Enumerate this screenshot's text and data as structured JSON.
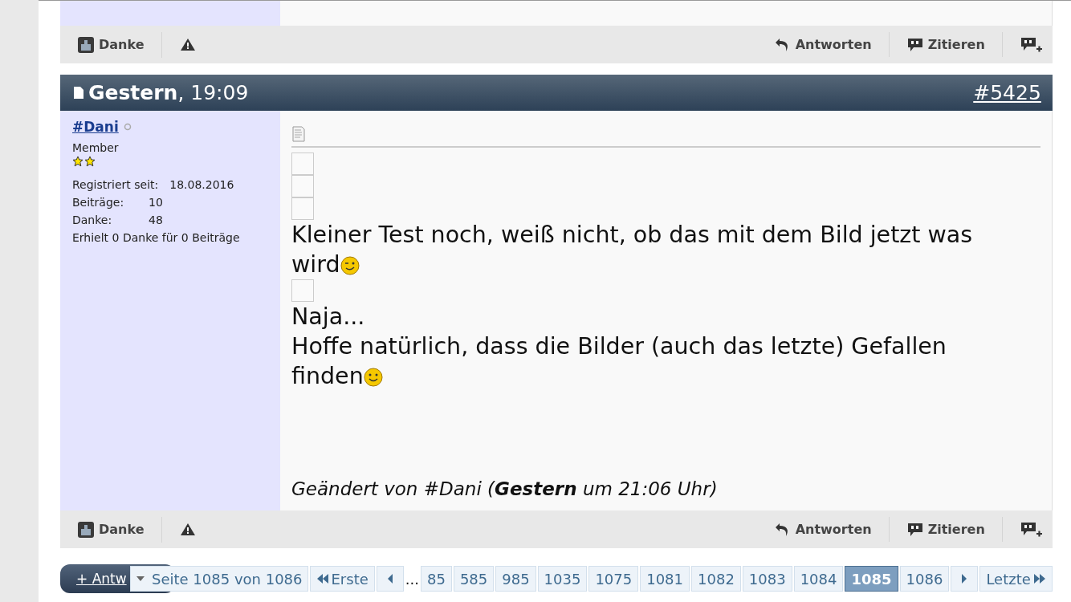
{
  "previous_post": {
    "actions": {
      "left": [
        {
          "kind": "thanks",
          "label": "Danke"
        },
        {
          "kind": "report"
        }
      ],
      "right": [
        {
          "kind": "reply",
          "label": "Antworten"
        },
        {
          "kind": "quote",
          "label": "Zitieren"
        },
        {
          "kind": "multiquote"
        }
      ]
    }
  },
  "post": {
    "header": {
      "date": "Gestern",
      "time": ", 19:09",
      "number": "#5425"
    },
    "user": {
      "name": "#Dani",
      "online": false,
      "rank": "Member",
      "stats": [
        {
          "label": "Registriert seit:",
          "value": "18.08.2016"
        },
        {
          "label": "Beiträge:",
          "value": "10"
        },
        {
          "label": "Danke:",
          "value": "48"
        }
      ],
      "thanks_note": "Erhielt 0 Danke für 0 Beiträge"
    },
    "body": [
      {
        "kind": "image"
      },
      {
        "kind": "image"
      },
      {
        "kind": "image"
      },
      {
        "kind": "text",
        "text": "Kleiner Test noch, weiß nicht, ob das mit dem Bild jetzt was wird",
        "emoticon": {
          "kind": "wink"
        }
      },
      {
        "kind": "image"
      },
      {
        "kind": "text",
        "text": "Naja..."
      },
      {
        "kind": "text",
        "text": "Hoffe natürlich, dass die Bilder (auch das letzte) Gefallen finden",
        "emoticon": {
          "kind": "smile"
        }
      }
    ],
    "edit_note": "Geändert von #Dani (**Gestern** um 21:06 Uhr)",
    "actions": {
      "left": [
        {
          "kind": "thanks",
          "label": "Danke"
        },
        {
          "kind": "report"
        }
      ],
      "right": [
        {
          "kind": "reply",
          "label": "Antworten"
        },
        {
          "kind": "quote",
          "label": "Zitieren"
        },
        {
          "kind": "multiquote"
        }
      ]
    }
  },
  "pagination": {
    "reply_button": "+ Antw",
    "page_label": "Seite 1085 von 1086",
    "first": "Erste",
    "ellipsis": "...",
    "last": "Letzte",
    "pages": [
      {
        "label": "85",
        "selected": false
      },
      {
        "label": "585",
        "selected": false
      },
      {
        "label": "985",
        "selected": false
      },
      {
        "label": "1035",
        "selected": false
      },
      {
        "label": "1075",
        "selected": false
      },
      {
        "label": "1081",
        "selected": false
      },
      {
        "label": "1082",
        "selected": false
      },
      {
        "label": "1083",
        "selected": false
      },
      {
        "label": "1084",
        "selected": false
      },
      {
        "label": "1085",
        "selected": true
      },
      {
        "label": "1086",
        "selected": false
      }
    ]
  }
}
